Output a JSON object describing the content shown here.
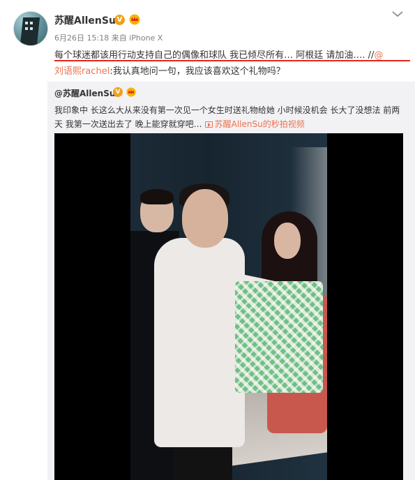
{
  "post": {
    "username": "苏醒AllenSu",
    "verified_badge": "V",
    "meta": "6月26日 15:18 来自 iPhone X",
    "text_line1": "每个球迷都该用行动支持自己的偶像和球队 我已倾尽所有… 阿根廷 请加油…. //",
    "text_line1_link": "@",
    "text_line2_mention": "刘语熙rachel",
    "text_line2_rest": ":我认真地问一句，我应该喜欢这个礼物吗？"
  },
  "repost": {
    "username": "@苏醒AllenSu",
    "verified_badge": "V",
    "text_line1": "我印象中 长这么大从来没有第一次见一个女生时送礼物给她 小时候没机会 长大了没想法 前两",
    "text_line2": "天 我第一次送出去了 晚上能穿就穿吧…",
    "video_link": "苏醒AllenSu的秒拍视频"
  },
  "colors": {
    "link": "#eb7350",
    "badge": "#f0a11a",
    "underline": "#e0281d",
    "repost_bg": "#f2f2f5"
  },
  "icons": {
    "chevron": "chevron-down-icon",
    "crown": "crown-icon",
    "video": "video-icon"
  }
}
